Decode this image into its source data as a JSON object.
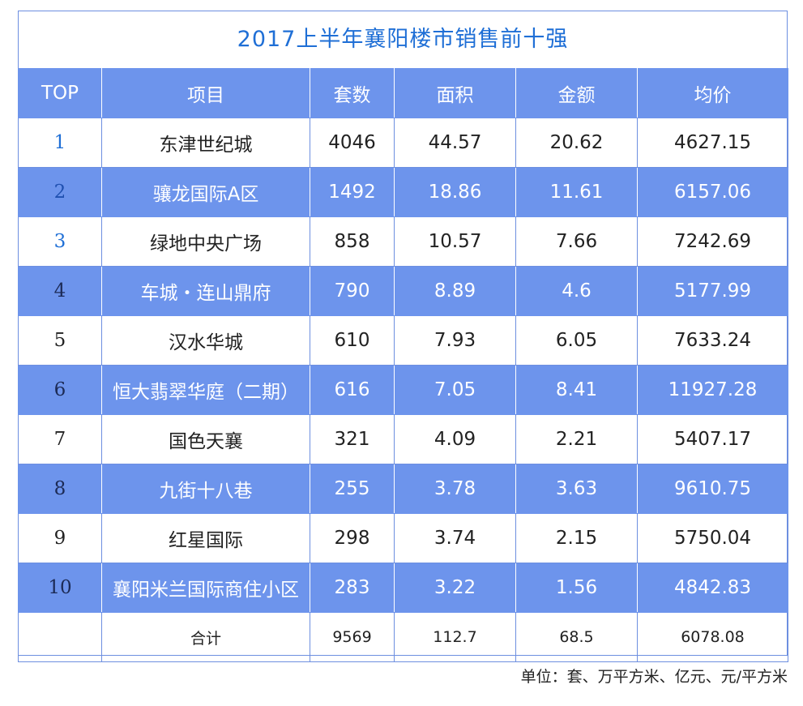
{
  "title": "2017上半年襄阳楼市销售前十强",
  "headers": [
    "TOP",
    "项目",
    "套数",
    "面积",
    "金额",
    "均价"
  ],
  "rows": [
    {
      "rank": "1",
      "project": "东津世纪城",
      "units": "4046",
      "area": "44.57",
      "amount": "20.62",
      "avg_price": "4627.15"
    },
    {
      "rank": "2",
      "project": "骧龙国际A区",
      "units": "1492",
      "area": "18.86",
      "amount": "11.61",
      "avg_price": "6157.06"
    },
    {
      "rank": "3",
      "project": "绿地中央广场",
      "units": "858",
      "area": "10.57",
      "amount": "7.66",
      "avg_price": "7242.69"
    },
    {
      "rank": "4",
      "project": "车城・连山鼎府",
      "units": "790",
      "area": "8.89",
      "amount": "4.6",
      "avg_price": "5177.99"
    },
    {
      "rank": "5",
      "project": "汉水华城",
      "units": "610",
      "area": "7.93",
      "amount": "6.05",
      "avg_price": "7633.24"
    },
    {
      "rank": "6",
      "project": "恒大翡翠华庭（二期）",
      "units": "616",
      "area": "7.05",
      "amount": "8.41",
      "avg_price": "11927.28"
    },
    {
      "rank": "7",
      "project": "国色天襄",
      "units": "321",
      "area": "4.09",
      "amount": "2.21",
      "avg_price": "5407.17"
    },
    {
      "rank": "8",
      "project": "九街十八巷",
      "units": "255",
      "area": "3.78",
      "amount": "3.63",
      "avg_price": "9610.75"
    },
    {
      "rank": "9",
      "project": "红星国际",
      "units": "298",
      "area": "3.74",
      "amount": "2.15",
      "avg_price": "5750.04"
    },
    {
      "rank": "10",
      "project": "襄阳米兰国际商住小区",
      "units": "283",
      "area": "3.22",
      "amount": "1.56",
      "avg_price": "4842.83"
    }
  ],
  "total": {
    "rank": "",
    "project": "合计",
    "units": "9569",
    "area": "112.7",
    "amount": "68.5",
    "avg_price": "6078.08"
  },
  "unit_note": "单位：套、万平方米、亿元、元/平方米",
  "colors": {
    "title": "#1f6fd6",
    "band": "#6d94ec",
    "border": "#6d8fe0",
    "text": "#222222"
  }
}
